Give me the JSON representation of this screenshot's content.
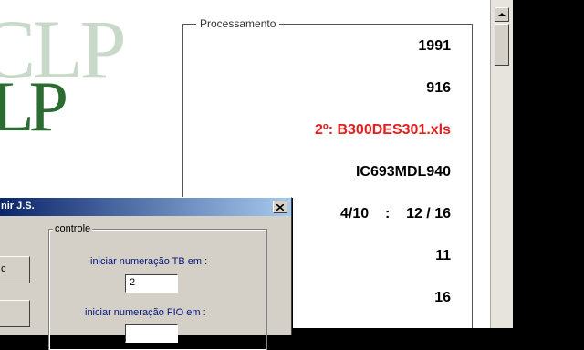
{
  "logo": {
    "big_text": "CLP",
    "small_text": "LP"
  },
  "processing": {
    "title": "Processamento",
    "values": [
      {
        "text": "1991",
        "color": "#000000"
      },
      {
        "text": "916",
        "color": "#000000"
      },
      {
        "text": "2º: B300DES301.xls",
        "color": "#e02020"
      },
      {
        "text": "IC693MDL940",
        "color": "#000000"
      },
      {
        "text": "4/10    :    12 / 16",
        "color": "#000000"
      },
      {
        "text": "11",
        "color": "#000000"
      },
      {
        "text": "16",
        "color": "#000000"
      }
    ]
  },
  "dialog": {
    "title": "nir J.S.",
    "close_symbol": "×",
    "left_button_label": "c",
    "group_label": "controle",
    "tb_label": "iniciar numeração TB em :",
    "tb_value": "2",
    "fio_label": "iniciar numeração FIO em :",
    "fio_value": ""
  }
}
